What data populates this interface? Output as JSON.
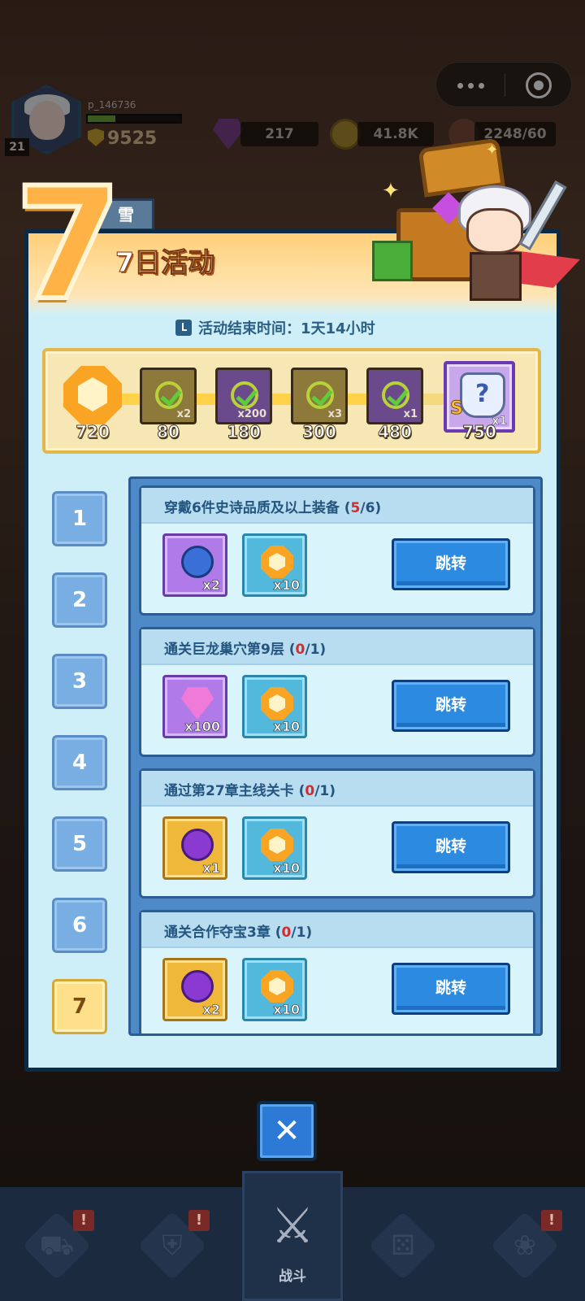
{
  "hud": {
    "level": "21",
    "player_name": "p_146736",
    "power": "9525",
    "gems": "217",
    "gold": "41.8K",
    "stamina": "2248/60",
    "exp_fraction": 0.3,
    "side_tab": "雪"
  },
  "panel": {
    "big_number": "7",
    "title": "7日活动",
    "timer": "活动结束时间：1天14小时"
  },
  "progress": {
    "score": "720",
    "fill_fraction": 0.78,
    "milestones": [
      {
        "value": "80",
        "qty": "x2",
        "style": "olive"
      },
      {
        "value": "180",
        "qty": "x200",
        "style": "purple"
      },
      {
        "value": "300",
        "qty": "x3",
        "style": "olive"
      },
      {
        "value": "480",
        "qty": "x1",
        "style": "purple"
      },
      {
        "value": "750",
        "qty": "x1",
        "style": "final",
        "icon_text": "?",
        "badge": "S"
      }
    ]
  },
  "days": [
    "1",
    "2",
    "3",
    "4",
    "5",
    "6",
    "7"
  ],
  "active_day": "7",
  "tasks": [
    {
      "title": "穿戴6件史诗品质及以上装备 (",
      "progress_done": "5",
      "progress_rest": "/6)",
      "rewards": [
        {
          "kind": "potion-blue",
          "style": "purple",
          "qty": "x2"
        },
        {
          "kind": "box",
          "style": "blue",
          "qty": "x10"
        }
      ],
      "button": "跳转"
    },
    {
      "title": "通关巨龙巢穴第9层 (",
      "progress_done": "0",
      "progress_rest": "/1)",
      "rewards": [
        {
          "kind": "diamond",
          "style": "purple",
          "qty": "x100"
        },
        {
          "kind": "box",
          "style": "blue",
          "qty": "x10"
        }
      ],
      "button": "跳转"
    },
    {
      "title": "通过第27章主线关卡 (",
      "progress_done": "0",
      "progress_rest": "/1)",
      "rewards": [
        {
          "kind": "potion-violet",
          "style": "gold",
          "qty": "x1"
        },
        {
          "kind": "box",
          "style": "blue",
          "qty": "x10"
        }
      ],
      "button": "跳转"
    },
    {
      "title": "通关合作夺宝3章 (",
      "progress_done": "0",
      "progress_rest": "/1)",
      "rewards": [
        {
          "kind": "potion-violet",
          "style": "gold",
          "qty": "x2"
        },
        {
          "kind": "box",
          "style": "blue",
          "qty": "x10"
        }
      ],
      "button": "跳转"
    }
  ],
  "nav": {
    "battle_label": "战斗",
    "badge": "!",
    "icons": [
      "shop-cart-icon",
      "armor-icon",
      "battle-swords-icon",
      "dice-icon",
      "paw-icon"
    ]
  },
  "colors": {
    "panel_bg": "#cfeff8",
    "accent_blue": "#2c8ae0",
    "progress_red": "#d22c2c",
    "gold": "#ffb347"
  }
}
